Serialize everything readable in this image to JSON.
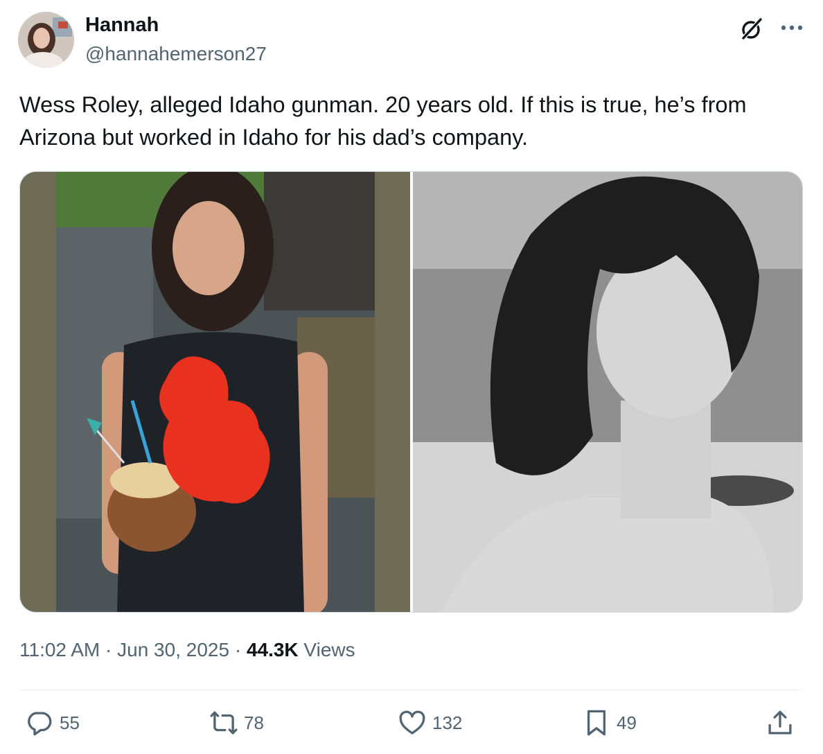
{
  "author": {
    "display_name": "Hannah",
    "handle": "@hannahemerson27"
  },
  "tweet": {
    "text": "Wess Roley, alleged Idaho gunman. 20 years old. If this is true, he’s from Arizona but worked in Idaho for his dad’s company.",
    "time": "11:02 AM",
    "sep1": " · ",
    "date": "Jun 30, 2025",
    "sep2": " · ",
    "views_count": "44.3K",
    "views_label": " Views"
  },
  "media": {
    "items": [
      {
        "icon": "photo-color"
      },
      {
        "icon": "photo-grayscale"
      }
    ]
  },
  "actions": {
    "replies": "55",
    "reposts": "78",
    "likes": "132",
    "bookmarks": "49"
  },
  "colors": {
    "text_primary": "#0f1419",
    "text_secondary": "#536471",
    "border": "#cfd9de",
    "redaction": "#e8321f"
  }
}
